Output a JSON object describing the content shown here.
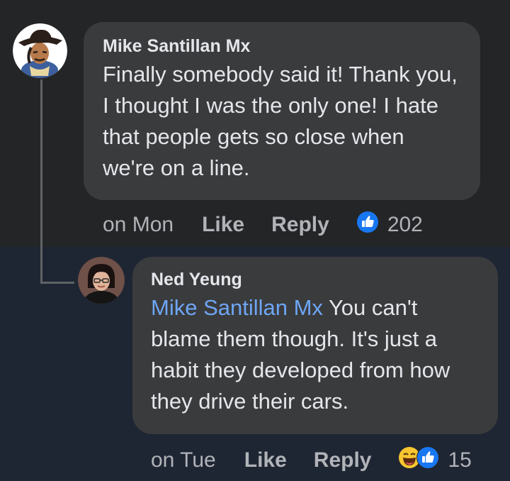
{
  "comments": [
    {
      "author": "Mike Santillan Mx",
      "text": "Finally somebody said it! Thank you, I thought I was the only one! I hate that people gets so close when we're on a line.",
      "mention": "",
      "time": "on Mon",
      "like_label": "Like",
      "reply_label": "Reply",
      "reactions": [
        "like-icon"
      ],
      "reaction_count": "202"
    },
    {
      "author": "Ned Yeung",
      "mention": "Mike Santillan Mx",
      "text": " You can't blame them though. It's just a habit they developed from how they drive their cars.",
      "time": "on Tue",
      "like_label": "Like",
      "reply_label": "Reply",
      "reactions": [
        "laugh-emoji-icon",
        "like-icon"
      ],
      "reaction_count": "15"
    }
  ],
  "colors": {
    "background_top": "#242526",
    "background_bottom": "#1f2633",
    "bubble": "#3a3b3c",
    "mention": "#6ea6f5",
    "like_blue": "#1877f2",
    "secondary_text": "#b0b3b8"
  }
}
